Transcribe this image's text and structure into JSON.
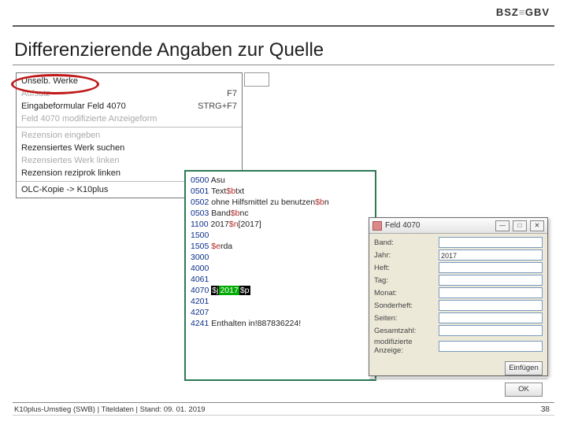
{
  "header": {
    "logo_left": "BSZ",
    "logo_right": "GBV",
    "title": "Differenzierende Angaben zur Quelle"
  },
  "menu": {
    "g1": [
      {
        "label": "Unselb. Werke",
        "shortcut": "",
        "blur": false
      },
      {
        "label": "Aufsatz",
        "shortcut": "F7",
        "blur": true
      },
      {
        "label": "Eingabeformular Feld 4070",
        "shortcut": "STRG+F7",
        "blur": false
      },
      {
        "label": "Feld 4070 modifizierte Anzeigeform",
        "shortcut": "",
        "blur": true
      }
    ],
    "g2": [
      {
        "label": "Rezension eingeben",
        "shortcut": "",
        "blur": true
      },
      {
        "label": "Rezensiertes Werk suchen",
        "shortcut": "",
        "blur": false
      },
      {
        "label": "Rezensiertes Werk linken",
        "shortcut": "",
        "blur": true
      },
      {
        "label": "Rezension reziprok linken",
        "shortcut": "",
        "blur": false
      }
    ],
    "g3": [
      {
        "label": "OLC-Kopie -> K10plus",
        "shortcut": "",
        "blur": false
      }
    ]
  },
  "record": [
    {
      "num": "0500",
      "parts": [
        {
          "t": "txt",
          "v": "Asu"
        }
      ]
    },
    {
      "num": "0501",
      "parts": [
        {
          "t": "txt",
          "v": "Text"
        },
        {
          "t": "sub",
          "v": "$b"
        },
        {
          "t": "txt",
          "v": "txt"
        }
      ]
    },
    {
      "num": "0502",
      "parts": [
        {
          "t": "txt",
          "v": "ohne Hilfsmittel zu benutzen"
        },
        {
          "t": "sub",
          "v": "$b"
        },
        {
          "t": "txt",
          "v": "n"
        }
      ]
    },
    {
      "num": "0503",
      "parts": [
        {
          "t": "txt",
          "v": "Band"
        },
        {
          "t": "sub",
          "v": "$b"
        },
        {
          "t": "txt",
          "v": "nc"
        }
      ]
    },
    {
      "num": "1100",
      "parts": [
        {
          "t": "txt",
          "v": "2017"
        },
        {
          "t": "sub",
          "v": "$n"
        },
        {
          "t": "txt",
          "v": "[2017]"
        }
      ]
    },
    {
      "num": "1500",
      "parts": []
    },
    {
      "num": "1505",
      "parts": [
        {
          "t": "sub",
          "v": "$e"
        },
        {
          "t": "txt",
          "v": "rda"
        }
      ]
    },
    {
      "num": "3000",
      "parts": []
    },
    {
      "num": "4000",
      "parts": []
    },
    {
      "num": "4061",
      "parts": []
    },
    {
      "num": "4070",
      "parts": [
        {
          "t": "hl-black",
          "v": "$j"
        },
        {
          "t": "hl-green",
          "v": "2017"
        },
        {
          "t": "hl-black",
          "v": "$p"
        }
      ]
    },
    {
      "num": "4201",
      "parts": []
    },
    {
      "num": "4207",
      "parts": []
    },
    {
      "num": "4241",
      "parts": [
        {
          "t": "txt",
          "v": "Enthalten in!887836224!"
        }
      ]
    }
  ],
  "dialog": {
    "title": "Feld 4070",
    "fields": [
      {
        "label": "Band:",
        "value": ""
      },
      {
        "label": "Jahr:",
        "value": "2017"
      },
      {
        "label": "Heft:",
        "value": ""
      },
      {
        "label": "Tag:",
        "value": ""
      },
      {
        "label": "Monat:",
        "value": ""
      },
      {
        "label": "Sonderheft:",
        "value": ""
      },
      {
        "label": "Seiten:",
        "value": ""
      },
      {
        "label": "Gesamtzahl:",
        "value": ""
      },
      {
        "label": "modifizierte Anzeige:",
        "value": ""
      }
    ],
    "btn_insert": "Einfügen",
    "btn_ok": "OK"
  },
  "footer": {
    "left": "K10plus-Umstieg (SWB) | Titeldaten | Stand: 09. 01. 2019",
    "page": "38"
  }
}
